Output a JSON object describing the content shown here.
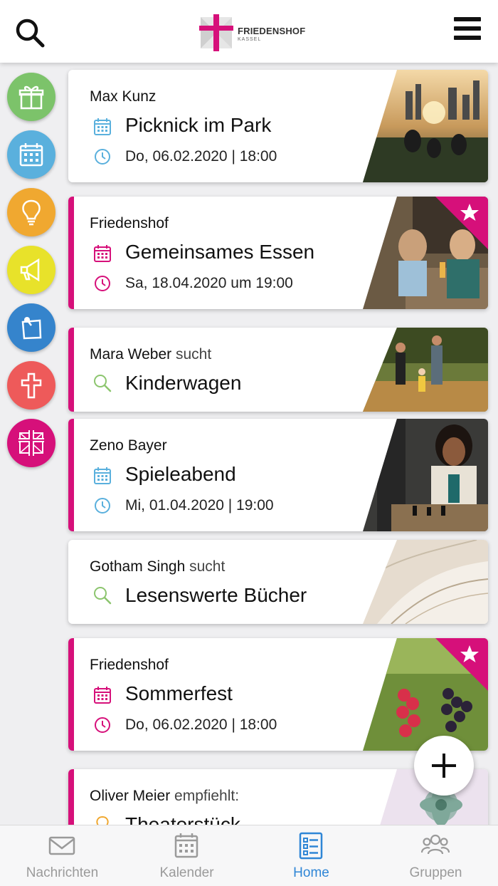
{
  "header": {
    "logo_name": "FRIEDENSHOF",
    "logo_sub": "KASSEL",
    "search_icon": "search-icon",
    "menu_icon": "hamburger-menu-icon"
  },
  "sidebar": {
    "items": [
      {
        "name": "gift-icon",
        "color": "#7cc36a"
      },
      {
        "name": "calendar-icon",
        "color": "#5ab0dd"
      },
      {
        "name": "lightbulb-icon",
        "color": "#f0a830"
      },
      {
        "name": "megaphone-icon",
        "color": "#e8e22a"
      },
      {
        "name": "pinned-note-icon",
        "color": "#3584cc"
      },
      {
        "name": "cross-icon",
        "color": "#ee5a5a"
      },
      {
        "name": "friedenshof-logo-icon",
        "color": "#d6107a"
      }
    ]
  },
  "colors": {
    "accent": "#d6107a",
    "event_blue": "#5ab0dd",
    "search_green": "#8cc56e",
    "recommend_orange": "#f0a830",
    "active_nav": "#2f86d6"
  },
  "cards": [
    {
      "author": "Max Kunz",
      "suffix": "",
      "title": "Picknick im Park",
      "date": "Do, 06.02.2020 | 18:00",
      "kind": "event",
      "highlight": false
    },
    {
      "author": "Friedenshof",
      "suffix": "",
      "title": "Gemeinsames Essen",
      "date": "Sa, 18.04.2020 um 19:00",
      "kind": "event",
      "highlight": true,
      "starred": true
    },
    {
      "author": "Mara Weber",
      "suffix": "sucht",
      "title": "Kinderwagen",
      "kind": "search",
      "highlight": true
    },
    {
      "author": "Zeno Bayer",
      "suffix": "",
      "title": "Spieleabend",
      "date": "Mi, 01.04.2020 | 19:00",
      "kind": "event",
      "highlight": true
    },
    {
      "author": "Gotham Singh",
      "suffix": "sucht",
      "title": "Lesenswerte Bücher",
      "kind": "search",
      "highlight": false
    },
    {
      "author": "Friedenshof",
      "suffix": "",
      "title": "Sommerfest",
      "date": "Do, 06.02.2020 | 18:00",
      "kind": "event",
      "highlight": true,
      "starred": true
    },
    {
      "author": "Oliver Meier",
      "suffix": "empfiehlt:",
      "title": "Theaterstück",
      "kind": "recommendation",
      "highlight": true
    }
  ],
  "fab": {
    "icon": "plus-icon"
  },
  "bottom_nav": {
    "items": [
      {
        "label": "Nachrichten",
        "icon": "envelope-icon",
        "active": false
      },
      {
        "label": "Kalender",
        "icon": "calendar-icon",
        "active": false
      },
      {
        "label": "Home",
        "icon": "list-icon",
        "active": true
      },
      {
        "label": "Gruppen",
        "icon": "group-icon",
        "active": false
      }
    ]
  }
}
